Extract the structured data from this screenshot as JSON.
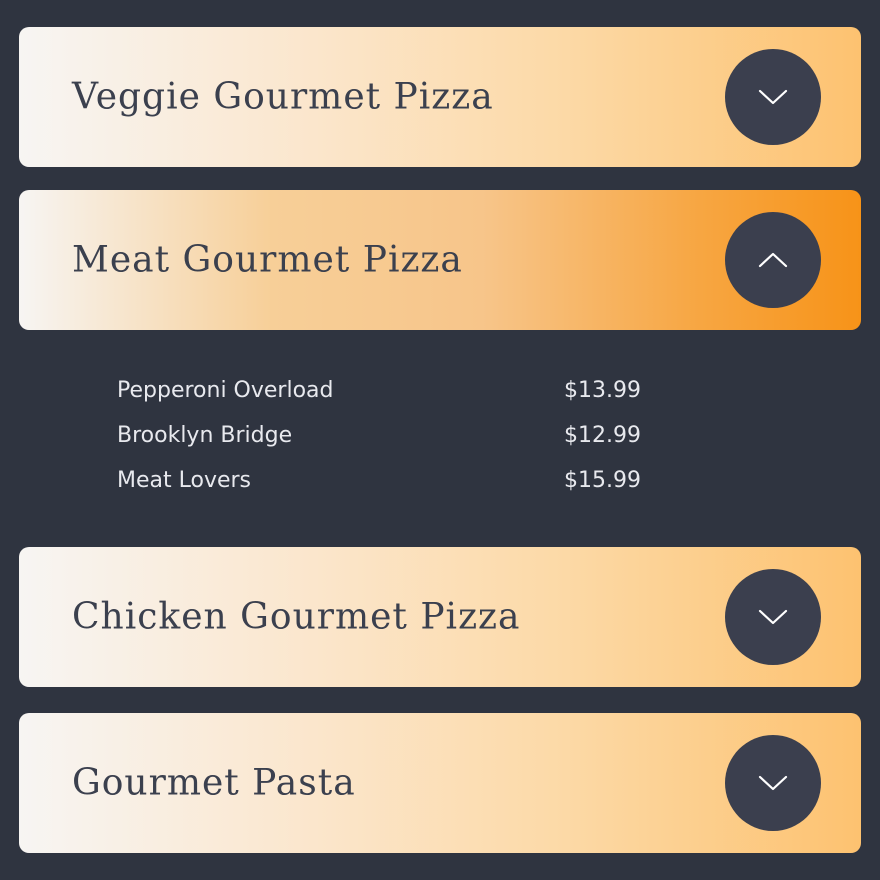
{
  "sections": [
    {
      "title": "Veggie Gourmet Pizza",
      "expanded": false,
      "toggle_icon": "chevron-down-icon"
    },
    {
      "title": "Meat Gourmet Pizza",
      "expanded": true,
      "toggle_icon": "chevron-up-icon"
    },
    {
      "title": "Chicken Gourmet Pizza",
      "expanded": false,
      "toggle_icon": "chevron-down-icon"
    },
    {
      "title": "Gourmet Pasta",
      "expanded": false,
      "toggle_icon": "chevron-down-icon"
    }
  ],
  "meat_items": [
    {
      "name": "Pepperoni Overload",
      "price": "$13.99"
    },
    {
      "name": "Brooklyn Bridge",
      "price": "$12.99"
    },
    {
      "name": "Meat Lovers",
      "price": "$15.99"
    }
  ],
  "colors": {
    "background": "#2f3440",
    "button": "#3b3f4e",
    "title_text": "#3b404e",
    "item_text": "#e8e9ee",
    "accent_orange": "#f79318"
  }
}
